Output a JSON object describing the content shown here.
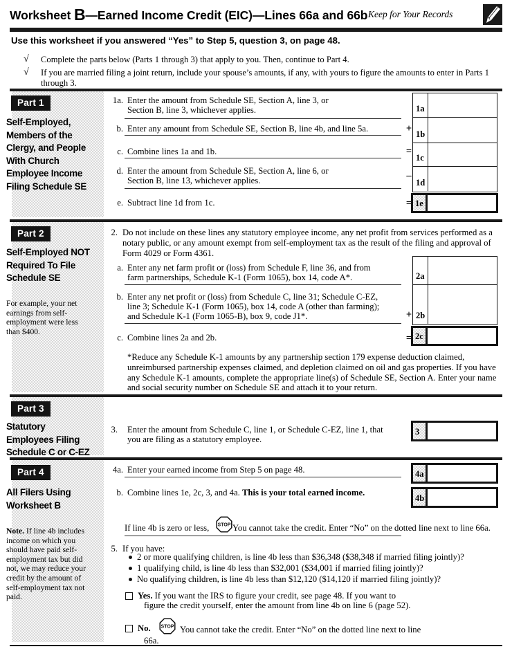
{
  "header": {
    "title_pre": "Worksheet ",
    "title_letter": "B",
    "title_post": "—Earned Income Credit (EIC)—Lines 66a and 66b",
    "keep_note": "Keep for Your Records",
    "icon": "pencil-records-icon"
  },
  "intro": {
    "heading": "Use this worksheet if you answered “Yes” to Step 5, question 3, on page 48.",
    "checkmark": "√",
    "items": [
      "Complete the parts below (Parts 1 through 3) that apply to you. Then, continue to Part 4.",
      "If you are married filing a joint return, include your spouse’s amounts, if any, with yours to figure the amounts to enter in Parts 1 through 3."
    ]
  },
  "part1": {
    "tag": "Part 1",
    "heading": "Self-Employed, Members of the Clergy, and People With Church Employee Income Filing Schedule SE",
    "lines": [
      {
        "num": "1a.",
        "text_l1": "Enter the amount from Schedule SE, Section A, line 3, or",
        "text_l2": "Section B, line 3, whichever applies.",
        "box": "1a",
        "op": ""
      },
      {
        "num": "b.",
        "text_l1": "Enter any amount from Schedule SE, Section B, line 4b, and line 5a.",
        "text_l2": "",
        "box": "1b",
        "op": "+"
      },
      {
        "num": "c.",
        "text_l1": "Combine lines 1a and 1b.",
        "text_l2": "",
        "box": "1c",
        "op": "="
      },
      {
        "num": "d.",
        "text_l1": "Enter the amount from Schedule SE, Section A, line 6, or",
        "text_l2": "Section B, line 13, whichever applies.",
        "box": "1d",
        "op": "–"
      },
      {
        "num": "e.",
        "text_l1": "Subtract line 1d from 1c.",
        "text_l2": "",
        "box": "1e",
        "op": "="
      }
    ]
  },
  "part2": {
    "tag": "Part 2",
    "heading": "Self-Employed NOT Required To File Schedule SE",
    "note": "For example, your net earnings from self-employment were less than $400.",
    "line2_num": "2.",
    "line2_text": "Do not include on these lines any statutory employee income, any net profit from services performed as a notary public, or any amount exempt from self-employment tax as the result of the filing and approval of Form 4029 or Form 4361.",
    "lines": [
      {
        "num": "a.",
        "text_l1": "Enter any net farm profit or (loss) from Schedule F, line 36, and from",
        "text_l2": "farm partnerships, Schedule K-1 (Form 1065), box 14, code A*.",
        "text_l3": "",
        "box": "2a",
        "op": ""
      },
      {
        "num": "b.",
        "text_l1": "Enter any net profit or (loss) from Schedule C, line 31; Schedule C-EZ,",
        "text_l2": "line 3; Schedule K-1 (Form 1065), box 14, code A (other than farming);",
        "text_l3": "and Schedule K-1 (Form 1065-B), box 9, code J1*.",
        "box": "2b",
        "op": "+"
      },
      {
        "num": "c.",
        "text_l1": "Combine lines 2a and 2b.",
        "text_l2": "",
        "text_l3": "",
        "box": "2c",
        "op": "="
      }
    ],
    "footnote": "*Reduce any Schedule K-1 amounts by any partnership section 179 expense deduction claimed, unreimbursed partnership expenses claimed, and depletion claimed on oil and gas properties. If you have any Schedule K-1 amounts, complete the appropriate line(s) of Schedule SE, Section A. Enter your name and social security number on Schedule SE and attach it to your return."
  },
  "part3": {
    "tag": "Part 3",
    "heading": "Statutory Employees Filing Schedule C or C-EZ",
    "line_num": "3.",
    "text_l1": "Enter the amount from Schedule C, line 1, or Schedule C-EZ, line 1, that",
    "text_l2": "you are filing as a statutory employee.",
    "box": "3"
  },
  "part4": {
    "tag": "Part 4",
    "heading": "All Filers Using Worksheet B",
    "note_label": "Note.",
    "note": "If line 4b includes income on which you should have paid self-employment tax but did not, we may reduce your credit by the amount of self-employment tax not paid.",
    "line4a_num": "4a.",
    "line4a_text": "Enter your earned income from Step 5 on page 48.",
    "line4a_box": "4a",
    "line4b_num": "b.",
    "line4b_text_pre": "Combine lines 1e, 2c, 3, and 4a. ",
    "line4b_text_bold": "This is your total earned income.",
    "line4b_box": "4b",
    "stop_label": "STOP",
    "zero_text_pre": "If line 4b is zero or less, ",
    "zero_text_post": "You cannot take the credit. Enter “No” on the dotted line next to line 66a.",
    "line5_num": "5.",
    "line5_text": "If you have:",
    "bullets": [
      "2 or more qualifying children, is line 4b less than $36,348 ($38,348 if married filing jointly)?",
      "1 qualifying child, is line 4b less than $32,001 ($34,001 if married filing jointly)?",
      "No qualifying children, is line 4b less than $12,120 ($14,120 if married filing jointly)?"
    ],
    "yes_label": "Yes.",
    "yes_text_l1": "If you want the IRS to figure your credit, see page 48. If you want to",
    "yes_text_l2": "figure the credit yourself, enter the amount from line 4b on line 6 (page 52).",
    "no_label": "No.",
    "no_text_l1": "You cannot take the credit. Enter “No” on the dotted line next to line",
    "no_text_l2": "66a."
  }
}
